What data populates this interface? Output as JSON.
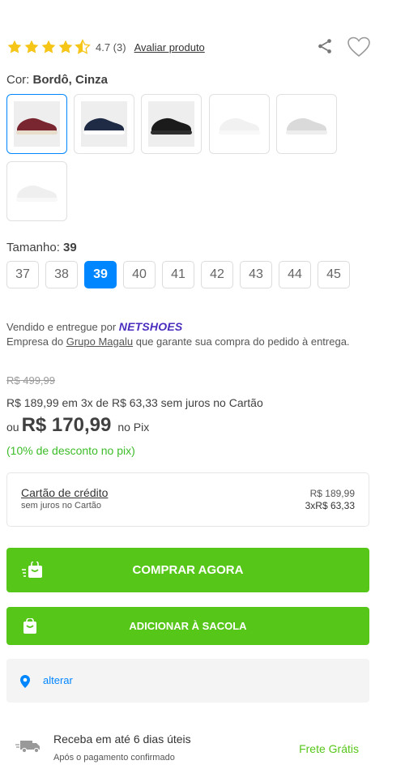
{
  "rating": {
    "stars_value": 4.7,
    "value_text": "4.7 (3)",
    "rate_link": "Avaliar produto",
    "star_color": "#f5c518"
  },
  "color": {
    "label": "Cor:",
    "value": "Bordô, Cinza",
    "swatches": [
      {
        "name": "burgundy-sneaker",
        "color": "#7a2630",
        "sole": "#e8dccb"
      },
      {
        "name": "navy-sneaker",
        "color": "#1f2a44",
        "sole": "#ffffff"
      },
      {
        "name": "black-sneaker",
        "color": "#1b1b1b",
        "sole": "#2e2e2e"
      },
      {
        "name": "white-sneaker",
        "color": "#f4f4f4",
        "sole": "#ffffff"
      },
      {
        "name": "gray-sneaker",
        "color": "#d8d8d8",
        "sole": "#eeeeee"
      },
      {
        "name": "white-sneaker-2",
        "color": "#f7f7f7",
        "sole": "#ffffff"
      }
    ]
  },
  "size": {
    "label": "Tamanho:",
    "value": "39",
    "options": [
      "37",
      "38",
      "39",
      "40",
      "41",
      "42",
      "43",
      "44",
      "45"
    ],
    "selected": "39"
  },
  "seller": {
    "prefix": "Vendido e entregue por",
    "brand": "NETSHOES",
    "company_prefix": "Empresa do",
    "company_link": "Grupo Magalu",
    "company_suffix": "que garante sua compra do pedido à entrega."
  },
  "price": {
    "old": "R$ 499,99",
    "installments": "R$ 189,99 em 3x de R$ 63,33 sem juros no Cartão",
    "ou": "ou",
    "pix_price": "R$ 170,99",
    "pix_label": "no Pix",
    "discount": "(10% de desconto no pix)"
  },
  "card": {
    "title": "Cartão de crédito",
    "subtitle": "sem juros no Cartão",
    "total": "R$ 189,99",
    "installment": "3xR$ 63,33"
  },
  "buttons": {
    "buy": "COMPRAR AGORA",
    "bag": "ADICIONAR À SACOLA",
    "color": "#56c619"
  },
  "location": {
    "link": "alterar"
  },
  "shipping": {
    "title": "Receba em até 6 dias úteis",
    "subtitle": "Após o pagamento confirmado",
    "free": "Frete Grátis"
  },
  "accent": "#0086ff"
}
